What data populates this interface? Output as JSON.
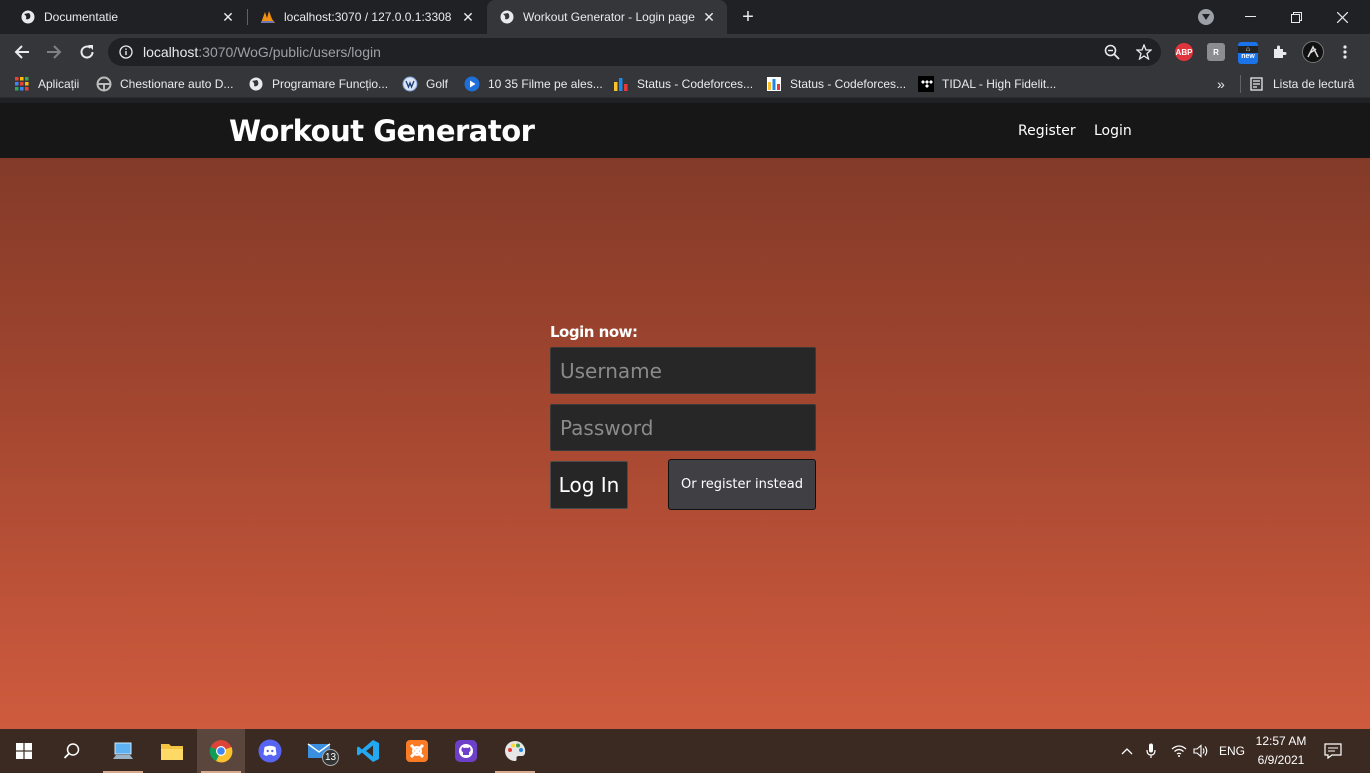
{
  "browser": {
    "tabs": [
      {
        "title": "Documentatie",
        "active": false
      },
      {
        "title": "localhost:3070 / 127.0.0.1:3308 /",
        "active": false
      },
      {
        "title": "Workout Generator - Login page",
        "active": true
      }
    ],
    "url_host": "localhost",
    "url_path": ":3070/WoG/public/users/login",
    "bookmarks": [
      "Aplicații",
      "Chestionare auto D...",
      "Programare Funcțio...",
      "Golf",
      "10 35 Filme pe ales...",
      "Status - Codeforces...",
      "Status - Codeforces...",
      "TIDAL - High Fidelit..."
    ],
    "more_bookmarks": "»",
    "reading_list": "Lista de lectură",
    "ext_abp": "ABP",
    "ext_new": "new"
  },
  "site": {
    "logo": "Workout Generator",
    "nav": {
      "register": "Register",
      "login": "Login"
    }
  },
  "login_form": {
    "heading": "Login now:",
    "username_placeholder": "Username",
    "password_placeholder": "Password",
    "login_button": "Log In",
    "register_button": "Or register instead"
  },
  "taskbar": {
    "mail_badge": "13",
    "language": "ENG",
    "time": "12:57 AM",
    "date": "6/9/2021"
  },
  "colors": {
    "header_bg": "#181717",
    "gradient_top": "#7c3827",
    "gradient_bottom": "#cf5b3e",
    "field_bg": "#272727",
    "register_btn_bg": "#3f3f44"
  }
}
